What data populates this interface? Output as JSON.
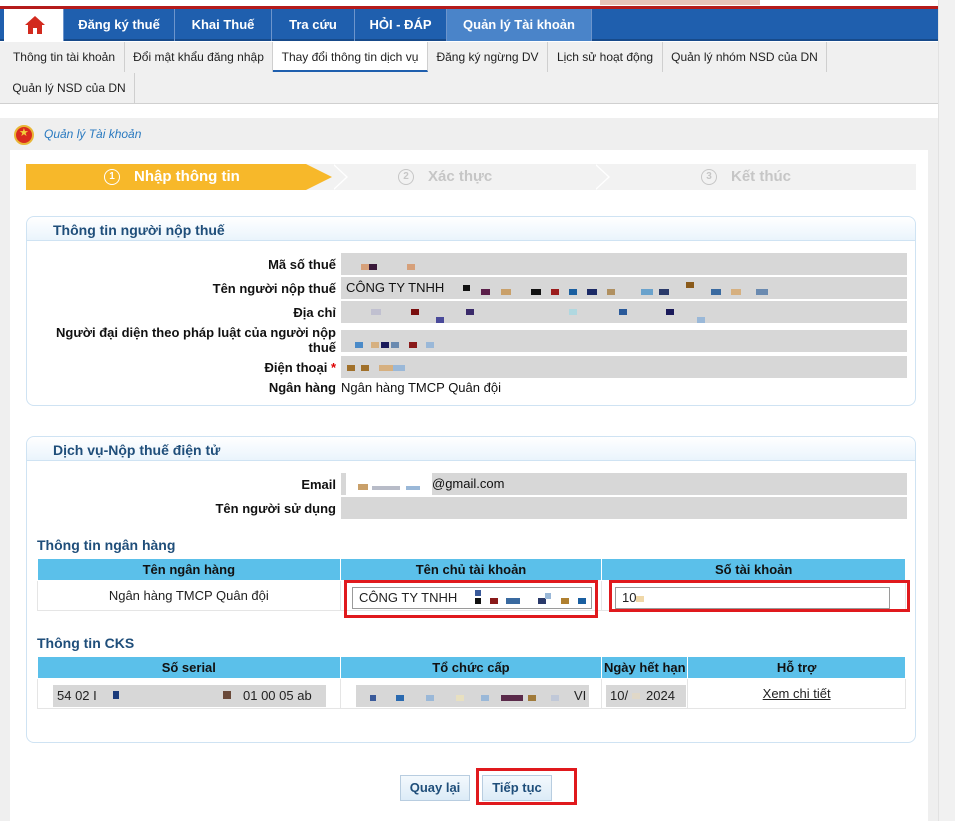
{
  "nav": {
    "items": [
      "Đăng ký thuế",
      "Khai Thuế",
      "Tra cứu",
      "HỎI - ĐÁP",
      "Quản lý Tài khoản"
    ],
    "active_index": 4
  },
  "subnav": {
    "items": [
      "Thông tin tài khoản",
      "Đổi mật khẩu đăng nhập",
      "Thay đổi thông tin dịch vụ",
      "Đăng ký ngừng DV",
      "Lịch sử hoạt động",
      "Quản lý nhóm NSD của DN",
      "Quản lý NSD của DN"
    ],
    "active_index": 2
  },
  "breadcrumb": "Quản lý Tài khoản",
  "wizard": {
    "steps": [
      {
        "num": "1",
        "label": "Nhập thông tin"
      },
      {
        "num": "2",
        "label": "Xác thực"
      },
      {
        "num": "3",
        "label": "Kết thúc"
      }
    ]
  },
  "taxpayer": {
    "title": "Thông tin người nộp thuế",
    "labels": {
      "mst": "Mã số thuế",
      "name": "Tên người nộp thuế",
      "address": "Địa chỉ",
      "rep": "Người đại diện theo pháp luật của người nộp thuế",
      "phone": "Điện thoại",
      "bank": "Ngân hàng"
    },
    "values": {
      "name": "CÔNG TY TNHH",
      "bank": "Ngân hàng TMCP Quân đội"
    }
  },
  "service": {
    "title": "Dịch vụ-Nộp thuế điện tử",
    "labels": {
      "email": "Email",
      "user": "Tên người sử dụng"
    },
    "values": {
      "email_suffix": "@gmail.com"
    }
  },
  "bank_info": {
    "title": "Thông tin ngân hàng",
    "headers": [
      "Tên ngân hàng",
      "Tên chủ tài khoản",
      "Số tài khoản"
    ],
    "row": {
      "bank": "Ngân hàng TMCP Quân đội",
      "holder": "CÔNG TY TNHH",
      "account": "10"
    }
  },
  "cks": {
    "title": "Thông tin CKS",
    "headers": [
      "Số serial",
      "Tổ chức cấp",
      "Ngày hết hạn",
      "Hỗ trợ"
    ],
    "row": {
      "serial_start": "54 02 I",
      "serial_end": "01 00 05 ab",
      "issuer_end": "VI",
      "expiry_start": "10/",
      "expiry_end": "2024",
      "support": "Xem chi tiết"
    }
  },
  "buttons": {
    "back": "Quay lại",
    "next": "Tiếp tục"
  },
  "colors": {
    "nav": "#1f5fae",
    "step_active": "#f7b82a",
    "table_header": "#5bc0ea",
    "highlight": "#e0191d"
  }
}
